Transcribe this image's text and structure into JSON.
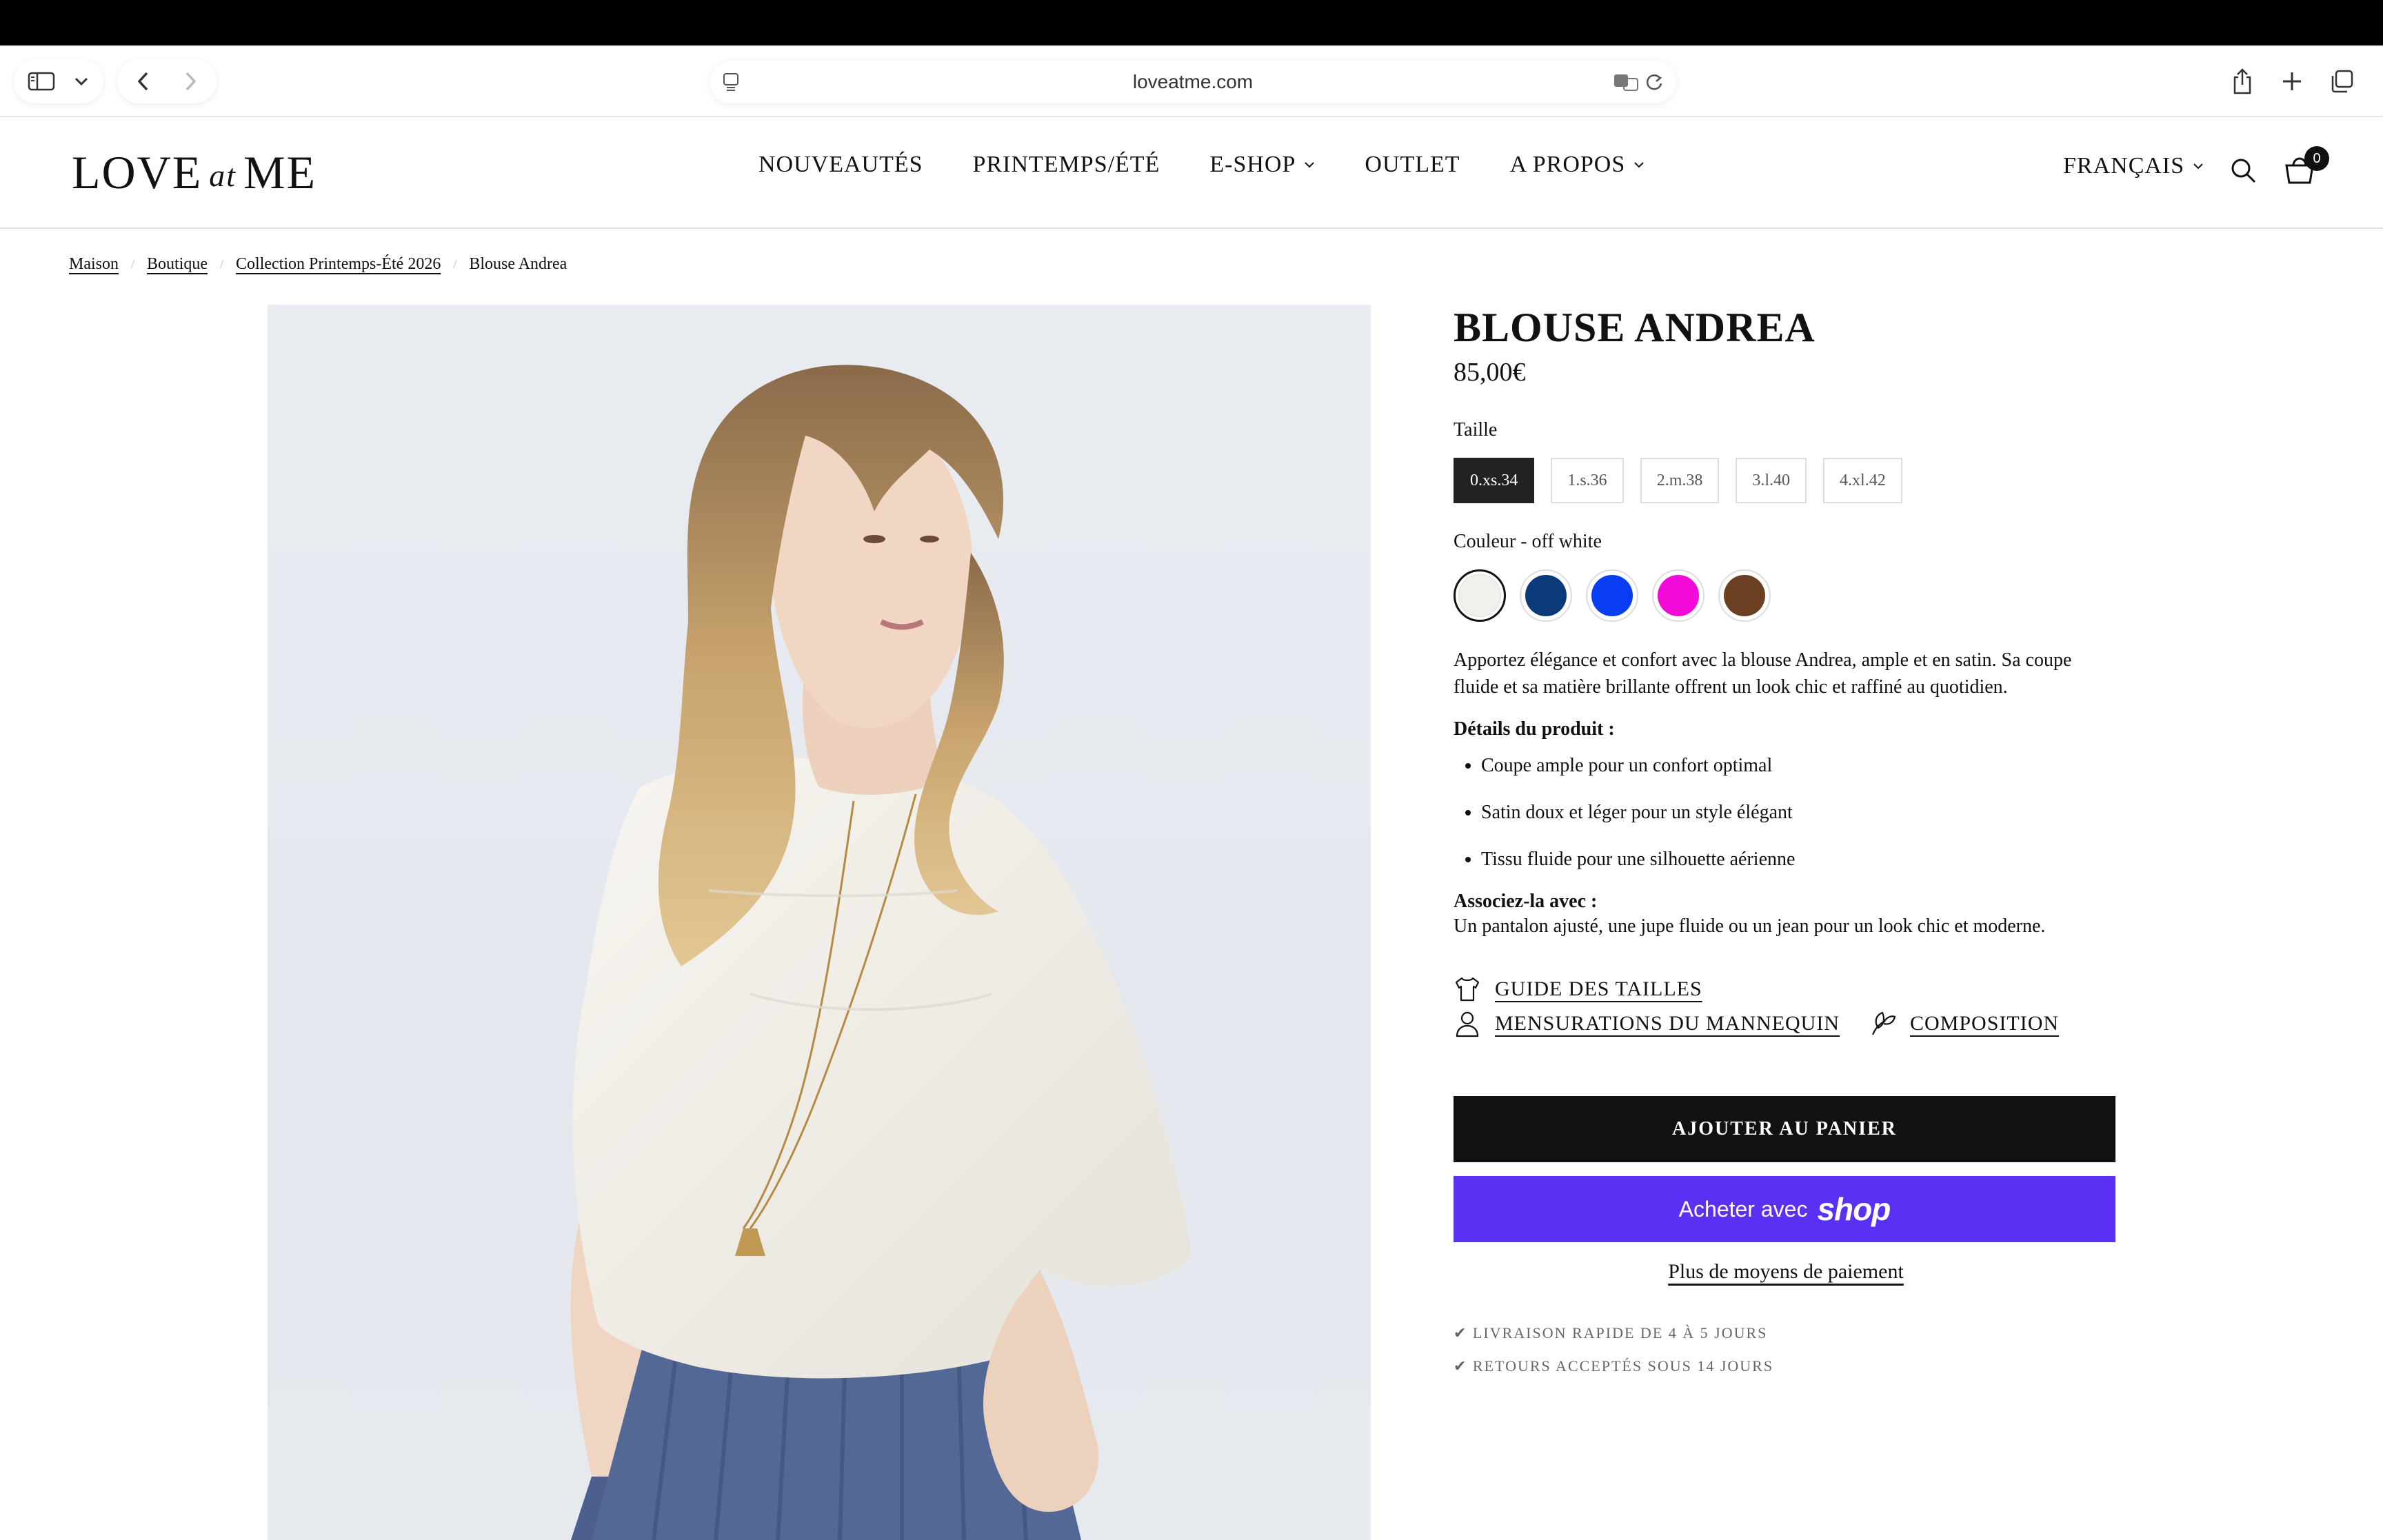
{
  "browser": {
    "url": "loveatme.com"
  },
  "header": {
    "logo_left": "LOVE",
    "logo_at": "at",
    "logo_right": "ME",
    "nav": [
      {
        "label": "NOUVEAUTÉS"
      },
      {
        "label": "PRINTEMPS/ÉTÉ"
      },
      {
        "label": "E-SHOP"
      },
      {
        "label": "OUTLET"
      },
      {
        "label": "A PROPOS"
      }
    ],
    "language": "FRANÇAIS",
    "cart_count": "0"
  },
  "breadcrumb": {
    "items": [
      "Maison",
      "Boutique",
      "Collection Printemps-Été 2026",
      "Blouse Andrea"
    ]
  },
  "product": {
    "title": "BLOUSE ANDREA",
    "price": "85,00€",
    "size_label": "Taille",
    "sizes": [
      "0.xs.34",
      "1.s.36",
      "2.m.38",
      "3.l.40",
      "4.xl.42"
    ],
    "selected_size": "0.xs.34",
    "color_label": "Couleur - off white",
    "colors": [
      {
        "name": "off white",
        "hex": "#f1f0ea"
      },
      {
        "name": "navy",
        "hex": "#0b3a7a"
      },
      {
        "name": "blue",
        "hex": "#0a3ef5"
      },
      {
        "name": "magenta",
        "hex": "#f20ad9"
      },
      {
        "name": "brown",
        "hex": "#6b3f22"
      }
    ],
    "description": "Apportez élégance et confort avec la blouse Andrea, ample et en satin. Sa coupe fluide et sa matière brillante offrent un look chic et raffiné au quotidien.",
    "details_title": "Détails du produit :",
    "details": [
      "Coupe ample pour un confort optimal",
      "Satin doux et léger pour un style élégant",
      "Tissu fluide pour une silhouette aérienne"
    ],
    "pair_title": "Associez-la avec :",
    "pair_text": "Un pantalon ajusté, une jupe fluide ou un jean pour un look chic et moderne.",
    "links": {
      "size_guide": "GUIDE DES TAILLES",
      "model": "MENSURATIONS DU MANNEQUIN",
      "composition": "COMPOSITION"
    },
    "add_to_cart": "AJOUTER AU PANIER",
    "shop_pay_prefix": "Acheter avec",
    "shop_pay_logo": "shop",
    "more_payment": "Plus de moyens de paiement",
    "guarantees": [
      "✔ LIVRAISON RAPIDE DE 4 À 5 JOURS",
      "✔ RETOURS ACCEPTÉS SOUS 14 JOURS"
    ]
  }
}
